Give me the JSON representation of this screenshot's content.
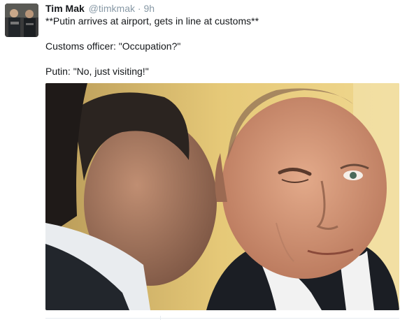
{
  "tweet": {
    "author_name": "Tim Mak",
    "author_handle": "@timkmak",
    "separator": "·",
    "timestamp": "9h",
    "text_lines": [
      "**Putin arrives at airport, gets in line at customs**",
      "Customs officer: \"Occupation?\"",
      "Putin: \"No, just visiting!\""
    ]
  },
  "icons": {
    "avatar": "profile-photo",
    "photo": "attached-image"
  }
}
